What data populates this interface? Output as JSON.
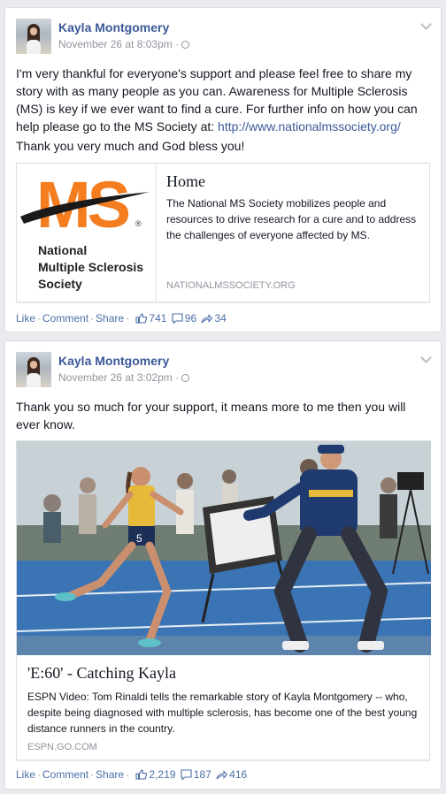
{
  "posts": [
    {
      "author": "Kayla Montgomery",
      "timestamp": "November 26 at 8:03pm",
      "text_main": "I'm very thankful for everyone's support and please feel free to share my story with as many people as you can. Awareness for Multiple Sclerosis (MS) is key if we ever want to find a cure. For further info on how you can help please go to the MS Society at: ",
      "text_link": "http://www.nationalmssociety.org/",
      "text_second": "Thank you very much and God bless you!",
      "card": {
        "logo_letters": "MS",
        "logo_reg": "®",
        "logo_name_1": "National",
        "logo_name_2": "Multiple Sclerosis",
        "logo_name_3": "Society",
        "title": "Home",
        "description": "The National MS Society mobilizes people and resources to drive research for a cure and to address the challenges of everyone affected by MS.",
        "domain": "NATIONALMSSOCIETY.ORG"
      },
      "actions": {
        "like": "Like",
        "comment": "Comment",
        "share": "Share",
        "likes": "741",
        "comments": "96",
        "shares": "34"
      }
    },
    {
      "author": "Kayla Montgomery",
      "timestamp": "November 26 at 3:02pm",
      "text_main": "Thank you so much for your support, it means more to me then you will ever know.",
      "card": {
        "bib_number": "5",
        "title": "'E:60' - Catching Kayla",
        "description": "ESPN Video: Tom Rinaldi tells the remarkable story of Kayla Montgomery -- who, despite being diagnosed with multiple sclerosis, has become one of the best young distance runners in the country.",
        "domain": "ESPN.GO.COM"
      },
      "actions": {
        "like": "Like",
        "comment": "Comment",
        "share": "Share",
        "likes": "2,219",
        "comments": "187",
        "shares": "416"
      }
    }
  ],
  "colors": {
    "link": "#3b5998",
    "ms_orange": "#f47d20",
    "meta": "#90949c"
  },
  "icons": [
    "avatar",
    "globe-icon",
    "chevron-down-icon",
    "like-icon",
    "comment-icon",
    "share-icon"
  ]
}
